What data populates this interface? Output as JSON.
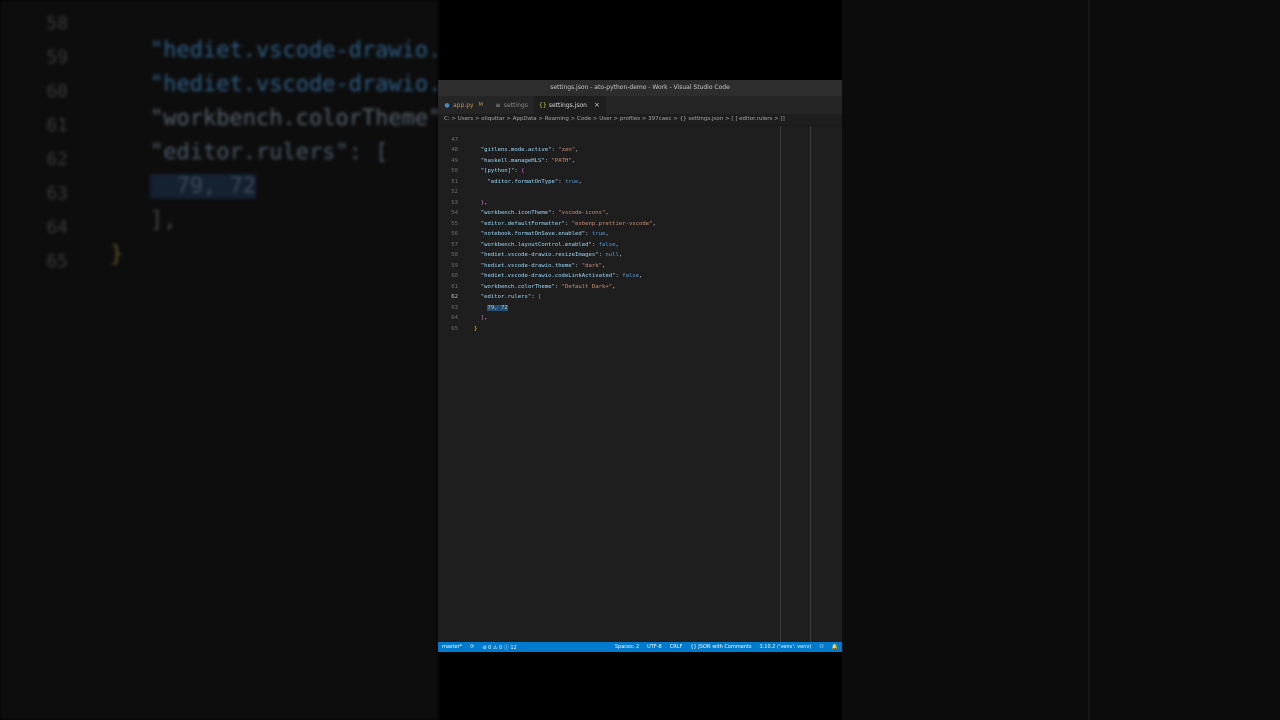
{
  "background": {
    "lines": [
      {
        "num": "58",
        "code": "\"hediet.vscode-drawio."
      },
      {
        "num": "59",
        "code": "\"hediet.vscode-drawio."
      },
      {
        "num": "60",
        "code": "\"workbench.colorTheme\""
      },
      {
        "num": "61",
        "code": "\"editor.rulers\": ["
      },
      {
        "num": "62",
        "code": "  79, 72"
      },
      {
        "num": "63",
        "code": "],"
      },
      {
        "num": "64",
        "code": "}"
      },
      {
        "num": "65",
        "code": ""
      }
    ]
  },
  "window": {
    "title": "settings.json - ato-python-demo - Work - Visual Studio Code"
  },
  "tabs": [
    {
      "label": "app.py",
      "modified": "M",
      "icon": "python-file-icon"
    },
    {
      "label": "settings",
      "icon": "settings-gear-icon"
    },
    {
      "label": "settings.json",
      "icon": "json-braces-icon",
      "close": "×"
    }
  ],
  "breadcrumb": "C: > Users > oliquttar > AppData > Roaming > Code > User > profiles > 397caec > {} settings.json > [ ] editor.rulers > []",
  "editor": {
    "rulers": [
      79,
      72
    ],
    "lines": [
      {
        "num": "47",
        "text": "  \"gitlens.mode.active\": \"zen\","
      },
      {
        "num": "48",
        "text": "  \"haskell.manageHLS\": \"PATH\","
      },
      {
        "num": "49",
        "text": "  \"[python]\": {"
      },
      {
        "num": "50",
        "text": "    \"editor.formatOnType\": true,"
      },
      {
        "num": "51",
        "text": ""
      },
      {
        "num": "52",
        "text": "  },"
      },
      {
        "num": "53",
        "text": "  \"workbench.iconTheme\": \"vscode-icons\","
      },
      {
        "num": "54",
        "text": "  \"editor.defaultFormatter\": \"esbenp.prettier-vscode\","
      },
      {
        "num": "55",
        "text": "  \"notebook.formatOnSave.enabled\": true,"
      },
      {
        "num": "56",
        "text": "  \"workbench.layoutControl.enabled\": false,"
      },
      {
        "num": "57",
        "text": "  \"hediet.vscode-drawio.resizeImages\": null,"
      },
      {
        "num": "58",
        "text": "  \"hediet.vscode-drawio.theme\": \"dark\","
      },
      {
        "num": "59",
        "text": "  \"hediet.vscode-drawio.codeLinkActivated\": false,"
      },
      {
        "num": "60",
        "text": "  \"workbench.colorTheme\": \"Default Dark+\","
      },
      {
        "num": "61",
        "text": "  \"editor.rulers\": ["
      },
      {
        "num": "62",
        "text": "    79, 72"
      },
      {
        "num": "63",
        "text": "  ],"
      },
      {
        "num": "64",
        "text": "}"
      },
      {
        "num": "65",
        "text": ""
      }
    ]
  },
  "statusbar": {
    "branch": "master*",
    "sync": "⟳",
    "problems": "⊘ 0 ⚠ 0 ⓘ 12",
    "indent": "Spaces: 2",
    "encoding": "UTF-8",
    "eol": "CRLF",
    "language": "{} JSON with Comments",
    "python": "3.10.2 ('venv': venv)",
    "accent": "#007acc"
  }
}
